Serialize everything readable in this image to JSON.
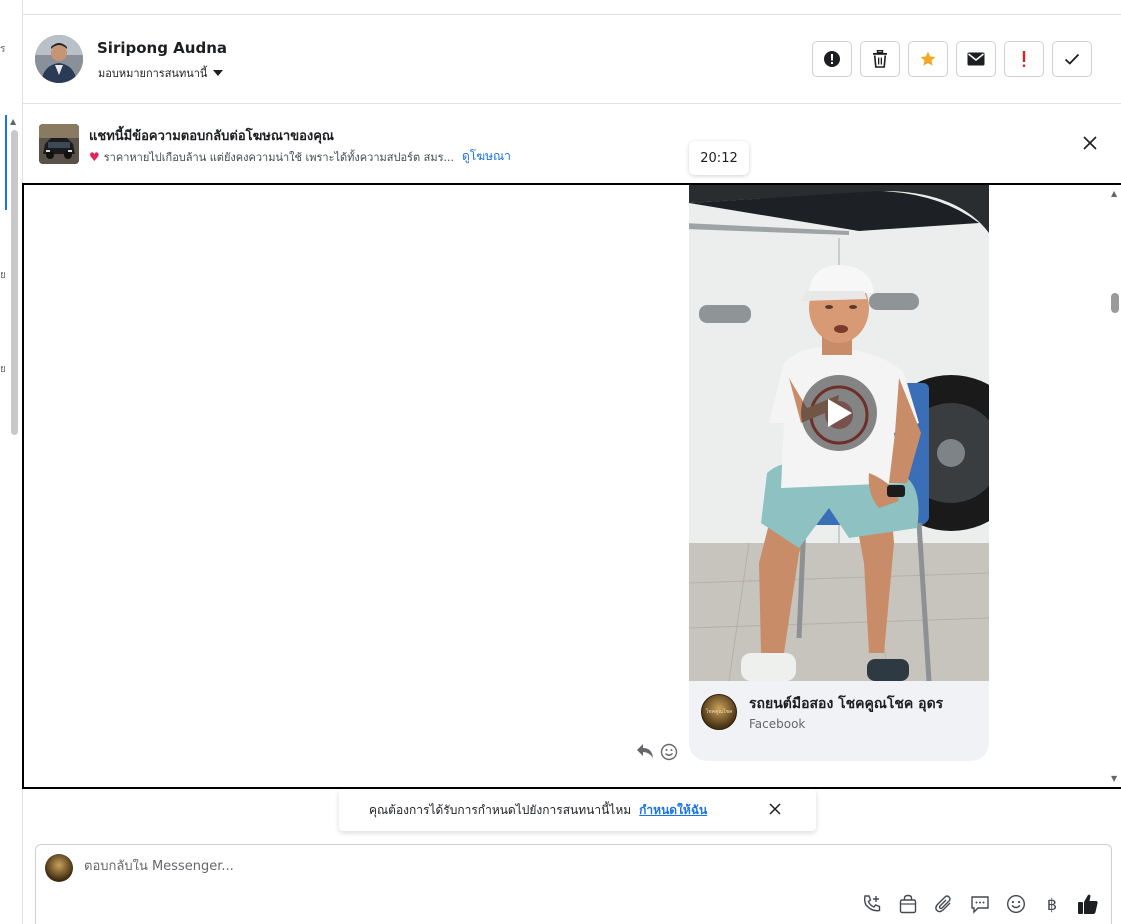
{
  "left_strip": {
    "fragments": [
      "ร",
      "ย",
      "ย"
    ]
  },
  "header": {
    "name": "Siripong Audna",
    "assign_label": "มอบหมายการสนทนานี้",
    "actions": [
      {
        "id": "spam",
        "icon": "alert-circle-icon"
      },
      {
        "id": "delete",
        "icon": "trash-icon"
      },
      {
        "id": "star",
        "icon": "star-icon",
        "color": "#f5a623"
      },
      {
        "id": "unread",
        "icon": "envelope-icon"
      },
      {
        "id": "follow-up",
        "icon": "exclamation-icon",
        "color": "#e02020"
      },
      {
        "id": "done",
        "icon": "check-icon"
      }
    ]
  },
  "ad_banner": {
    "title": "แชทนี้มีข้อความตอบกลับต่อโฆษณาของคุณ",
    "snippet": "ราคาหายไปเกือบล้าน แต่ยังคงความน่าใช้ เพราะได้ทั้งความสปอร์ต สมร...",
    "link": "ดูโฆษณา"
  },
  "tooltip": {
    "time": "20:12"
  },
  "message": {
    "page_name": "รถยนต์มือสอง โชคคูณโชค อุดร",
    "source": "Facebook",
    "logo_text": "โชคคูณโชค"
  },
  "followup": {
    "text": "คุณต้องการได้รับการกำหนดไปยังการสนทนานี้ไหม",
    "link": "กำหนดให้ฉัน"
  },
  "composer": {
    "placeholder": "ตอบกลับใน Messenger...",
    "value": "",
    "baht": "฿"
  }
}
